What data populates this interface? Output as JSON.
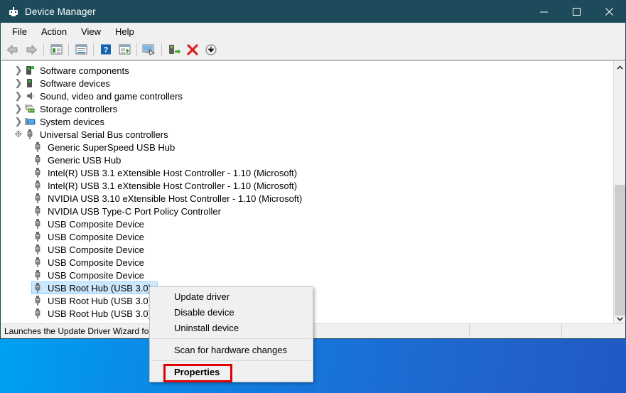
{
  "window": {
    "title": "Device Manager",
    "title_icon": "device-manager-icon",
    "minimize_label": "─",
    "maximize_label": "□",
    "close_label": "✕"
  },
  "menubar": {
    "items": [
      {
        "label": "File",
        "name": "menu-file"
      },
      {
        "label": "Action",
        "name": "menu-action"
      },
      {
        "label": "View",
        "name": "menu-view"
      },
      {
        "label": "Help",
        "name": "menu-help"
      }
    ]
  },
  "toolbar": {
    "buttons": [
      {
        "icon": "back-arrow-icon",
        "tooltip": "Back"
      },
      {
        "icon": "forward-arrow-icon",
        "tooltip": "Forward"
      },
      {
        "icon": "show-hide-console-tree-icon",
        "tooltip": "Show/Hide Console Tree"
      },
      {
        "icon": "properties-icon",
        "tooltip": "Properties"
      },
      {
        "icon": "help-icon",
        "tooltip": "Help"
      },
      {
        "icon": "show-hide-action-pane-icon",
        "tooltip": "Show/Hide Action Pane"
      },
      {
        "icon": "scan-for-hardware-changes-icon",
        "tooltip": "Scan for hardware changes"
      },
      {
        "icon": "update-driver-icon",
        "tooltip": "Update driver"
      },
      {
        "icon": "uninstall-device-icon",
        "tooltip": "Uninstall device"
      },
      {
        "icon": "disable-device-icon",
        "tooltip": "Disable device"
      }
    ]
  },
  "tree": {
    "nodes": [
      {
        "label": "Software components",
        "level": 1,
        "expander": "collapsed",
        "icon": "software-component-icon"
      },
      {
        "label": "Software devices",
        "level": 1,
        "expander": "collapsed",
        "icon": "software-device-icon"
      },
      {
        "label": "Sound, video and game controllers",
        "level": 1,
        "expander": "collapsed",
        "icon": "speaker-icon"
      },
      {
        "label": "Storage controllers",
        "level": 1,
        "expander": "collapsed",
        "icon": "storage-controller-icon"
      },
      {
        "label": "System devices",
        "level": 1,
        "expander": "collapsed",
        "icon": "system-device-icon"
      },
      {
        "label": "Universal Serial Bus controllers",
        "level": 1,
        "expander": "expanded",
        "icon": "usb-icon"
      },
      {
        "label": "Generic SuperSpeed USB Hub",
        "level": 2,
        "expander": "none",
        "icon": "usb-icon"
      },
      {
        "label": "Generic USB Hub",
        "level": 2,
        "expander": "none",
        "icon": "usb-icon"
      },
      {
        "label": "Intel(R) USB 3.1 eXtensible Host Controller - 1.10 (Microsoft)",
        "level": 2,
        "expander": "none",
        "icon": "usb-icon"
      },
      {
        "label": "Intel(R) USB 3.1 eXtensible Host Controller - 1.10 (Microsoft)",
        "level": 2,
        "expander": "none",
        "icon": "usb-icon"
      },
      {
        "label": "NVIDIA USB 3.10 eXtensible Host Controller - 1.10 (Microsoft)",
        "level": 2,
        "expander": "none",
        "icon": "usb-icon"
      },
      {
        "label": "NVIDIA USB Type-C Port Policy Controller",
        "level": 2,
        "expander": "none",
        "icon": "usb-icon"
      },
      {
        "label": "USB Composite Device",
        "level": 2,
        "expander": "none",
        "icon": "usb-icon"
      },
      {
        "label": "USB Composite Device",
        "level": 2,
        "expander": "none",
        "icon": "usb-icon"
      },
      {
        "label": "USB Composite Device",
        "level": 2,
        "expander": "none",
        "icon": "usb-icon"
      },
      {
        "label": "USB Composite Device",
        "level": 2,
        "expander": "none",
        "icon": "usb-icon"
      },
      {
        "label": "USB Composite Device",
        "level": 2,
        "expander": "none",
        "icon": "usb-icon"
      },
      {
        "label": "USB Root Hub (USB 3.0)",
        "level": 2,
        "expander": "none",
        "icon": "usb-icon",
        "selected": true
      },
      {
        "label": "USB Root Hub (USB 3.0)",
        "level": 2,
        "expander": "none",
        "icon": "usb-icon"
      },
      {
        "label": "USB Root Hub (USB 3.0)",
        "level": 2,
        "expander": "none",
        "icon": "usb-icon"
      }
    ],
    "selection_color": "#cce8ff"
  },
  "context_menu": {
    "items": [
      {
        "label": "Update driver",
        "name": "ctx-update-driver",
        "bold": false
      },
      {
        "label": "Disable device",
        "name": "ctx-disable-device",
        "bold": false
      },
      {
        "label": "Uninstall device",
        "name": "ctx-uninstall-device",
        "bold": false
      },
      {
        "separator": true
      },
      {
        "label": "Scan for hardware changes",
        "name": "ctx-scan-for-hardware-changes",
        "bold": false
      },
      {
        "separator": true
      },
      {
        "label": "Properties",
        "name": "ctx-properties",
        "bold": true,
        "highlighted": true
      }
    ],
    "highlight_border_color": "#e00000"
  },
  "statusbar": {
    "message": "Launches the Update Driver Wizard for the selected device.",
    "cell2": "",
    "cell3": ""
  },
  "colors": {
    "titlebar": "#1d4b5c",
    "window_bg": "#f0f0f0",
    "tree_bg": "#ffffff",
    "desktop_left": "#00a8f3",
    "desktop_right": "#2059c4"
  },
  "scrollbar": {
    "up_arrow": "⌃",
    "down_arrow": "⌄"
  }
}
